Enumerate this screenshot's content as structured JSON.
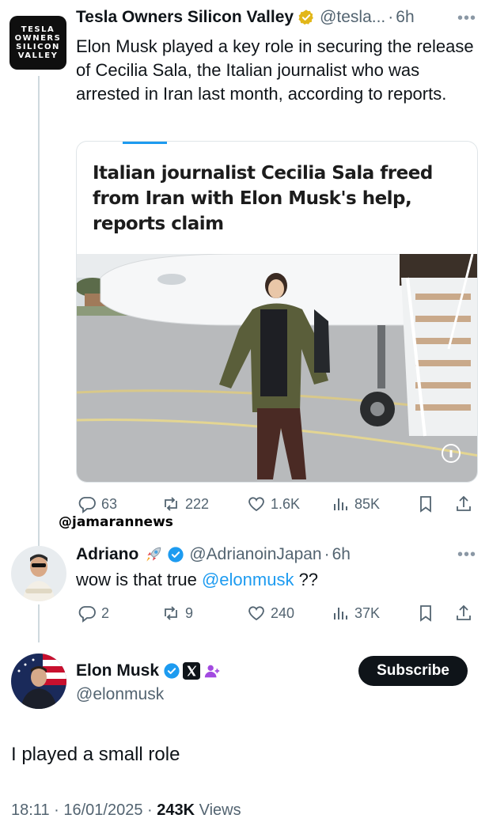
{
  "tweet1": {
    "avatar_text": [
      "TESLA",
      "OWNERS",
      "SILICON",
      "VALLEY"
    ],
    "name": "Tesla Owners Silicon Valley",
    "handle": "@tesla...",
    "time": "6h",
    "text": "Elon Musk played a key role in securing the release of Cecilia Sala, the Italian journalist who was arrested in Iran last month, according to reports.",
    "card_headline": "Italian journalist Cecilia Sala freed from Iran with Elon Musk's help, reports claim",
    "stats": {
      "replies": "63",
      "reposts": "222",
      "likes": "1.6K",
      "views": "85K"
    }
  },
  "watermark": "@jamarannews",
  "tweet2": {
    "name": "Adriano",
    "handle": "@AdrianoinJapan",
    "time": "6h",
    "text_prefix": "wow is that true ",
    "mention": "@elonmusk",
    "text_suffix": " ??",
    "stats": {
      "replies": "2",
      "reposts": "9",
      "likes": "240",
      "views": "37K"
    }
  },
  "tweet3": {
    "name": "Elon Musk",
    "handle": "@elonmusk",
    "subscribe_label": "Subscribe",
    "text": "I played a small role",
    "time": "18:11",
    "date": "16/01/2025",
    "views_count": "243K",
    "views_label": "Views"
  },
  "colors": {
    "accent": "#1d9bf0",
    "verified": "#1d9bf0",
    "badge_gold": "#e2b719",
    "muted": "#536471"
  },
  "icons": [
    "reply-icon",
    "repost-icon",
    "like-icon",
    "views-icon",
    "bookmark-icon",
    "share-icon",
    "verified-badge-icon",
    "rocket-icon",
    "x-logo-icon",
    "person-plus-icon",
    "more-icon"
  ]
}
